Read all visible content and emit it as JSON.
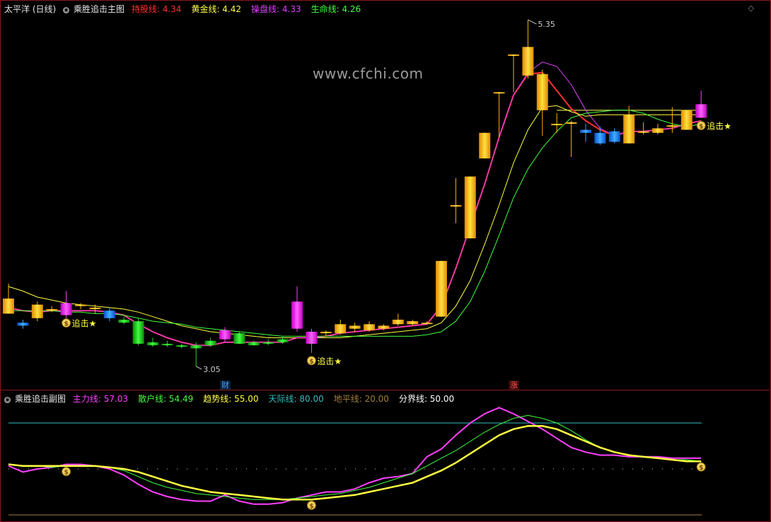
{
  "main_header": {
    "title": "太平洋 (日线)",
    "indicator_name": "乘胜追击主图",
    "items": [
      {
        "label": "持股线: 4.34",
        "color": "#ff3030"
      },
      {
        "label": "黄金线: 4.42",
        "color": "#ffff40"
      },
      {
        "label": "操盘线: 4.33",
        "color": "#e040ff"
      },
      {
        "label": "生命线: 4.26",
        "color": "#40ff40"
      }
    ]
  },
  "sub_header": {
    "indicator_name": "乘胜追击副图",
    "items": [
      {
        "label": "主力线: 57.03",
        "color": "#ff40ff"
      },
      {
        "label": "散户线: 54.49",
        "color": "#40ff40"
      },
      {
        "label": "趋势线: 55.00",
        "color": "#ffff40"
      },
      {
        "label": "天际线: 80.00",
        "color": "#30c0c0"
      },
      {
        "label": "地平线: 20.00",
        "color": "#a08040"
      },
      {
        "label": "分界线: 50.00",
        "color": "#ffffff"
      }
    ]
  },
  "watermark": "www.cfchi.com",
  "markers": {
    "cai": "财",
    "zhang": "涨"
  },
  "annotations": {
    "high_label": "5.35",
    "low_label": "3.05",
    "signal_label": "追击★",
    "money_glyph": "$"
  },
  "colors": {
    "up": "#ffb000",
    "up_fill": "#ffc820",
    "down_blue": "#1e90ff",
    "down_green": "#22cc22",
    "magenta": "#ff30ff",
    "frame": "#8a1a1a"
  },
  "chart_data": [
    {
      "type": "candlestick",
      "title": "乘胜追击主图",
      "price_range": [
        3.05,
        5.35
      ],
      "candles": [
        {
          "o": 3.5,
          "h": 3.6,
          "l": 3.4,
          "c": 3.4,
          "col": "up"
        },
        {
          "o": 3.32,
          "h": 3.36,
          "l": 3.3,
          "c": 3.34,
          "col": "blue"
        },
        {
          "o": 3.46,
          "h": 3.48,
          "l": 3.35,
          "c": 3.37,
          "col": "up"
        },
        {
          "o": 3.43,
          "h": 3.45,
          "l": 3.41,
          "c": 3.42,
          "col": "up"
        },
        {
          "o": 3.47,
          "h": 3.55,
          "l": 3.36,
          "c": 3.39,
          "col": "magenta"
        },
        {
          "o": 3.45,
          "h": 3.47,
          "l": 3.43,
          "c": 3.46,
          "col": "up"
        },
        {
          "o": 3.44,
          "h": 3.46,
          "l": 3.4,
          "c": 3.43,
          "col": "up"
        },
        {
          "o": 3.42,
          "h": 3.44,
          "l": 3.35,
          "c": 3.37,
          "col": "blue"
        },
        {
          "o": 3.36,
          "h": 3.38,
          "l": 3.33,
          "c": 3.34,
          "col": "green"
        },
        {
          "o": 3.35,
          "h": 3.37,
          "l": 3.19,
          "c": 3.2,
          "col": "green"
        },
        {
          "o": 3.21,
          "h": 3.24,
          "l": 3.18,
          "c": 3.19,
          "col": "green"
        },
        {
          "o": 3.2,
          "h": 3.22,
          "l": 3.18,
          "c": 3.19,
          "col": "green"
        },
        {
          "o": 3.19,
          "h": 3.2,
          "l": 3.17,
          "c": 3.18,
          "col": "green"
        },
        {
          "o": 3.19,
          "h": 3.21,
          "l": 3.05,
          "c": 3.17,
          "col": "green"
        },
        {
          "o": 3.22,
          "h": 3.24,
          "l": 3.18,
          "c": 3.19,
          "col": "green"
        },
        {
          "o": 3.29,
          "h": 3.31,
          "l": 3.21,
          "c": 3.23,
          "col": "magenta"
        },
        {
          "o": 3.27,
          "h": 3.28,
          "l": 3.2,
          "c": 3.2,
          "col": "green"
        },
        {
          "o": 3.21,
          "h": 3.22,
          "l": 3.19,
          "c": 3.19,
          "col": "green"
        },
        {
          "o": 3.21,
          "h": 3.23,
          "l": 3.19,
          "c": 3.2,
          "col": "green"
        },
        {
          "o": 3.23,
          "h": 3.25,
          "l": 3.2,
          "c": 3.21,
          "col": "green"
        },
        {
          "o": 3.48,
          "h": 3.58,
          "l": 3.28,
          "c": 3.3,
          "col": "magenta"
        },
        {
          "o": 3.28,
          "h": 3.3,
          "l": 3.14,
          "c": 3.2,
          "col": "magenta"
        },
        {
          "o": 3.27,
          "h": 3.29,
          "l": 3.25,
          "c": 3.28,
          "col": "up"
        },
        {
          "o": 3.27,
          "h": 3.36,
          "l": 3.26,
          "c": 3.33,
          "col": "up"
        },
        {
          "o": 3.3,
          "h": 3.34,
          "l": 3.28,
          "c": 3.32,
          "col": "up"
        },
        {
          "o": 3.29,
          "h": 3.35,
          "l": 3.28,
          "c": 3.33,
          "col": "up"
        },
        {
          "o": 3.3,
          "h": 3.33,
          "l": 3.29,
          "c": 3.32,
          "col": "up"
        },
        {
          "o": 3.33,
          "h": 3.4,
          "l": 3.32,
          "c": 3.36,
          "col": "up"
        },
        {
          "o": 3.33,
          "h": 3.36,
          "l": 3.32,
          "c": 3.35,
          "col": "up"
        },
        {
          "o": 3.34,
          "h": 3.35,
          "l": 3.33,
          "c": 3.34,
          "col": "up"
        },
        {
          "o": 3.38,
          "h": 3.75,
          "l": 3.38,
          "c": 3.75,
          "col": "up"
        },
        {
          "o": 4.12,
          "h": 4.3,
          "l": 4.0,
          "c": 4.12,
          "col": "up"
        },
        {
          "o": 3.9,
          "h": 4.31,
          "l": 3.9,
          "c": 4.31,
          "col": "up"
        },
        {
          "o": 4.43,
          "h": 4.6,
          "l": 4.43,
          "c": 4.6,
          "col": "up"
        },
        {
          "o": 4.87,
          "h": 4.87,
          "l": 4.57,
          "c": 4.87,
          "col": "up"
        },
        {
          "o": 5.12,
          "h": 5.12,
          "l": 4.87,
          "c": 5.12,
          "col": "up"
        },
        {
          "o": 4.98,
          "h": 5.35,
          "l": 4.96,
          "c": 5.17,
          "col": "up"
        },
        {
          "o": 4.75,
          "h": 5.02,
          "l": 4.58,
          "c": 4.99,
          "col": "up"
        },
        {
          "o": 4.65,
          "h": 4.73,
          "l": 4.6,
          "c": 4.66,
          "col": "up"
        },
        {
          "o": 4.67,
          "h": 4.68,
          "l": 4.44,
          "c": 4.66,
          "col": "up"
        },
        {
          "o": 4.62,
          "h": 4.66,
          "l": 4.54,
          "c": 4.6,
          "col": "blue"
        },
        {
          "o": 4.6,
          "h": 4.64,
          "l": 4.52,
          "c": 4.53,
          "col": "blue"
        },
        {
          "o": 4.61,
          "h": 4.63,
          "l": 4.53,
          "c": 4.54,
          "col": "blue"
        },
        {
          "o": 4.53,
          "h": 4.78,
          "l": 4.53,
          "c": 4.72,
          "col": "up"
        },
        {
          "o": 4.6,
          "h": 4.67,
          "l": 4.59,
          "c": 4.61,
          "col": "up"
        },
        {
          "o": 4.6,
          "h": 4.66,
          "l": 4.59,
          "c": 4.63,
          "col": "up"
        },
        {
          "o": 4.64,
          "h": 4.77,
          "l": 4.6,
          "c": 4.65,
          "col": "up"
        },
        {
          "o": 4.62,
          "h": 4.75,
          "l": 4.62,
          "c": 4.75,
          "col": "up"
        },
        {
          "o": 4.7,
          "h": 4.88,
          "l": 4.7,
          "c": 4.79,
          "col": "magenta"
        }
      ],
      "ma_series": [
        {
          "name": "持股线",
          "color": "#ff3030",
          "values": [
            3.44,
            3.42,
            3.41,
            3.42,
            3.42,
            3.42,
            3.42,
            3.41,
            3.39,
            3.33,
            3.28,
            3.24,
            3.21,
            3.19,
            3.19,
            3.21,
            3.21,
            3.21,
            3.21,
            3.21,
            3.24,
            3.24,
            3.25,
            3.27,
            3.28,
            3.29,
            3.3,
            3.31,
            3.32,
            3.33,
            3.45,
            3.7,
            3.98,
            4.26,
            4.57,
            4.85,
            4.99,
            5.0,
            4.88,
            4.76,
            4.68,
            4.62,
            4.58,
            4.61,
            4.61,
            4.62,
            4.63,
            4.66,
            4.68
          ]
        },
        {
          "name": "黄金线",
          "color": "#ffff40",
          "values": [
            3.58,
            3.55,
            3.51,
            3.49,
            3.47,
            3.46,
            3.45,
            3.44,
            3.43,
            3.41,
            3.38,
            3.35,
            3.32,
            3.3,
            3.28,
            3.27,
            3.26,
            3.25,
            3.24,
            3.24,
            3.24,
            3.24,
            3.24,
            3.24,
            3.25,
            3.26,
            3.27,
            3.28,
            3.29,
            3.3,
            3.34,
            3.45,
            3.62,
            3.86,
            4.12,
            4.4,
            4.62,
            4.77,
            4.78,
            4.74,
            4.71,
            4.72,
            4.72,
            4.72,
            4.72,
            4.72,
            4.72,
            4.72,
            4.72
          ]
        },
        {
          "name": "操盘线",
          "color": "#e040ff",
          "values": [
            3.44,
            3.42,
            3.41,
            3.42,
            3.42,
            3.42,
            3.42,
            3.41,
            3.39,
            3.33,
            3.28,
            3.24,
            3.21,
            3.19,
            3.19,
            3.21,
            3.21,
            3.21,
            3.21,
            3.21,
            3.24,
            3.24,
            3.25,
            3.27,
            3.28,
            3.29,
            3.3,
            3.31,
            3.32,
            3.33,
            3.45,
            3.7,
            3.98,
            4.26,
            4.57,
            4.85,
            5.0,
            5.07,
            5.04,
            4.92,
            4.75,
            4.63,
            4.58,
            4.61,
            4.61,
            4.62,
            4.63,
            4.66,
            4.68
          ]
        },
        {
          "name": "生命线",
          "color": "#40ff40",
          "values": [
            3.42,
            3.42,
            3.42,
            3.42,
            3.41,
            3.41,
            3.4,
            3.4,
            3.39,
            3.37,
            3.35,
            3.34,
            3.33,
            3.31,
            3.3,
            3.29,
            3.28,
            3.27,
            3.26,
            3.25,
            3.25,
            3.25,
            3.25,
            3.25,
            3.25,
            3.25,
            3.25,
            3.25,
            3.25,
            3.26,
            3.28,
            3.35,
            3.48,
            3.68,
            3.92,
            4.17,
            4.36,
            4.5,
            4.61,
            4.7,
            4.73,
            4.74,
            4.75,
            4.75,
            4.73,
            4.69,
            4.66,
            4.64,
            4.66
          ]
        }
      ],
      "horizontal_line": 4.75
    },
    {
      "type": "line",
      "title": "乘胜追击副图",
      "ylim": [
        10,
        100
      ],
      "series": [
        {
          "name": "主力线",
          "color": "#ff40ff",
          "values": [
            52,
            48,
            50,
            51,
            53,
            53,
            52,
            50,
            46,
            40,
            35,
            32,
            30,
            29,
            29,
            33,
            29,
            27,
            27,
            28,
            31,
            33,
            35,
            35,
            37,
            41,
            44,
            45,
            47,
            58,
            63,
            72,
            80,
            86,
            90,
            86,
            81,
            76,
            70,
            64,
            61,
            59,
            59,
            58,
            58,
            58,
            57,
            57,
            57
          ]
        },
        {
          "name": "散户线",
          "color": "#40ff40",
          "values": [
            53,
            52,
            52,
            51,
            52,
            52,
            52,
            51,
            49,
            45,
            41,
            38,
            36,
            34,
            33,
            32,
            31,
            30,
            30,
            30,
            31,
            32,
            33,
            34,
            36,
            38,
            41,
            44,
            47,
            52,
            57,
            62,
            68,
            74,
            79,
            83,
            85,
            83,
            80,
            75,
            69,
            64,
            61,
            59,
            58,
            57,
            56,
            56,
            55
          ]
        },
        {
          "name": "趋势线",
          "color": "#ffff40",
          "values": [
            53,
            52,
            52,
            52,
            52,
            52,
            52,
            51,
            50,
            48,
            45,
            42,
            39,
            37,
            35,
            34,
            33,
            32,
            31,
            30,
            30,
            30,
            31,
            32,
            33,
            35,
            37,
            39,
            41,
            45,
            49,
            54,
            60,
            66,
            72,
            76,
            78,
            78,
            76,
            72,
            68,
            64,
            61,
            59,
            58,
            57,
            56,
            55,
            55
          ]
        }
      ],
      "reference_lines": [
        {
          "name": "天际线",
          "value": 80,
          "color": "#30c0c0"
        },
        {
          "name": "地平线",
          "value": 20,
          "color": "#a08040"
        },
        {
          "name": "分界线",
          "value": 50,
          "color": "#ffffff"
        }
      ]
    }
  ]
}
